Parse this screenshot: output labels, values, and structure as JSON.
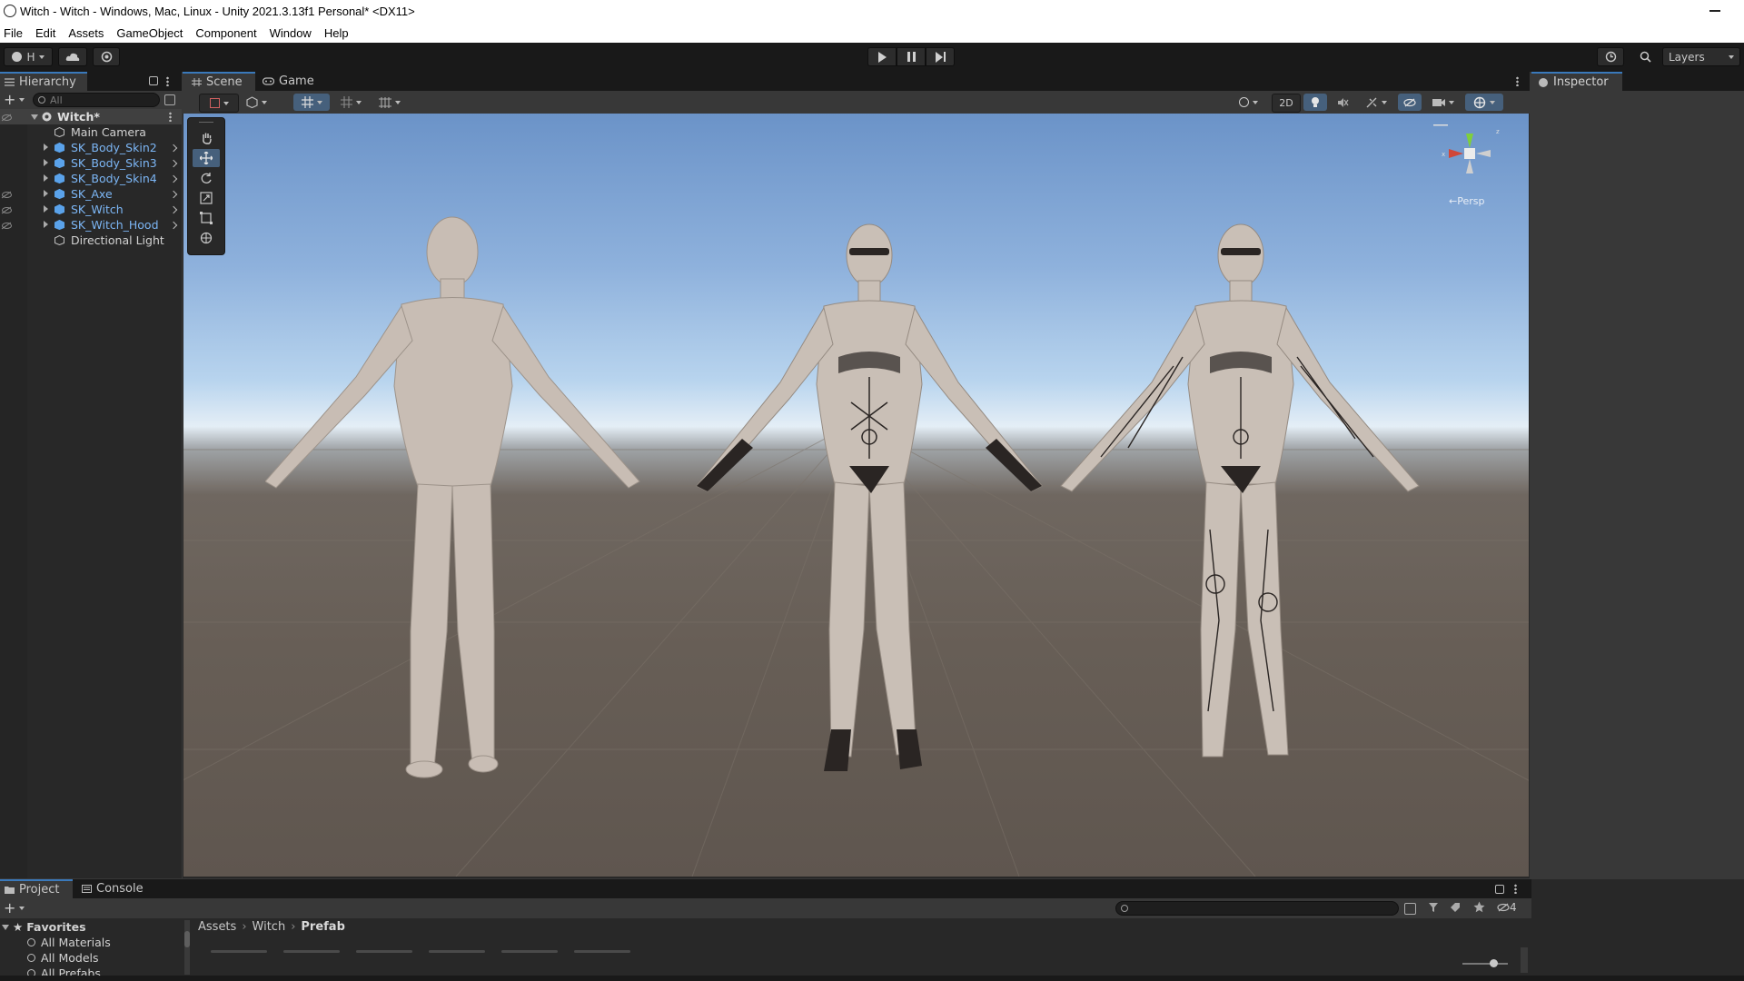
{
  "window": {
    "title": "Witch - Witch - Windows, Mac, Linux - Unity 2021.3.13f1 Personal* <DX11>"
  },
  "menu": [
    "File",
    "Edit",
    "Assets",
    "GameObject",
    "Component",
    "Window",
    "Help"
  ],
  "toolbar": {
    "account_label": "H",
    "layers_label": "Layers"
  },
  "hierarchy": {
    "tab_label": "Hierarchy",
    "search_placeholder": "All",
    "root": "Witch*",
    "items": [
      {
        "label": "Main Camera",
        "prefab": false,
        "hidden": false
      },
      {
        "label": "SK_Body_Skin2",
        "prefab": true,
        "hidden": false
      },
      {
        "label": "SK_Body_Skin3",
        "prefab": true,
        "hidden": false
      },
      {
        "label": "SK_Body_Skin4",
        "prefab": true,
        "hidden": false
      },
      {
        "label": "SK_Axe",
        "prefab": true,
        "hidden": true
      },
      {
        "label": "SK_Witch",
        "prefab": true,
        "hidden": true
      },
      {
        "label": "SK_Witch_Hood",
        "prefab": true,
        "hidden": true
      },
      {
        "label": "Directional Light",
        "prefab": false,
        "hidden": false
      }
    ]
  },
  "scene": {
    "tabs": [
      "Scene",
      "Game"
    ],
    "toggle_2d_label": "2D",
    "camera_label": "←Persp"
  },
  "inspector": {
    "tab_label": "Inspector"
  },
  "project": {
    "tabs": [
      "Project",
      "Console"
    ],
    "favorites_label": "Favorites",
    "favorites": [
      "All Materials",
      "All Models",
      "All Prefabs"
    ],
    "breadcrumb": [
      "Assets",
      "Witch",
      "Prefab"
    ],
    "hidden_count": "4"
  },
  "colors": {
    "accent": "#3a79bb",
    "prefab_text": "#7cb6f5",
    "panel_bg": "#282828",
    "toolbar_bg": "#191919"
  }
}
